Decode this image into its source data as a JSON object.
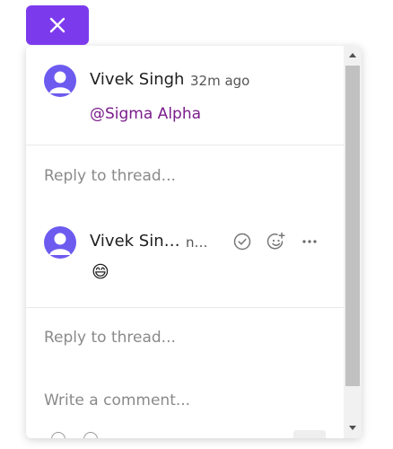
{
  "thread1": {
    "author": "Vivek Singh",
    "time": "32m ago",
    "mention": "@Sigma Alpha",
    "reply_placeholder": "Reply to thread..."
  },
  "thread2": {
    "author": "Vivek Sin…",
    "time": "n…",
    "emoji": "😄",
    "reply_placeholder": "Reply to thread..."
  },
  "composer": {
    "placeholder": "Write a comment..."
  },
  "colors": {
    "accent": "#7c3aed",
    "avatar": "#6d5bf0",
    "mention": "#7a1c8c"
  }
}
